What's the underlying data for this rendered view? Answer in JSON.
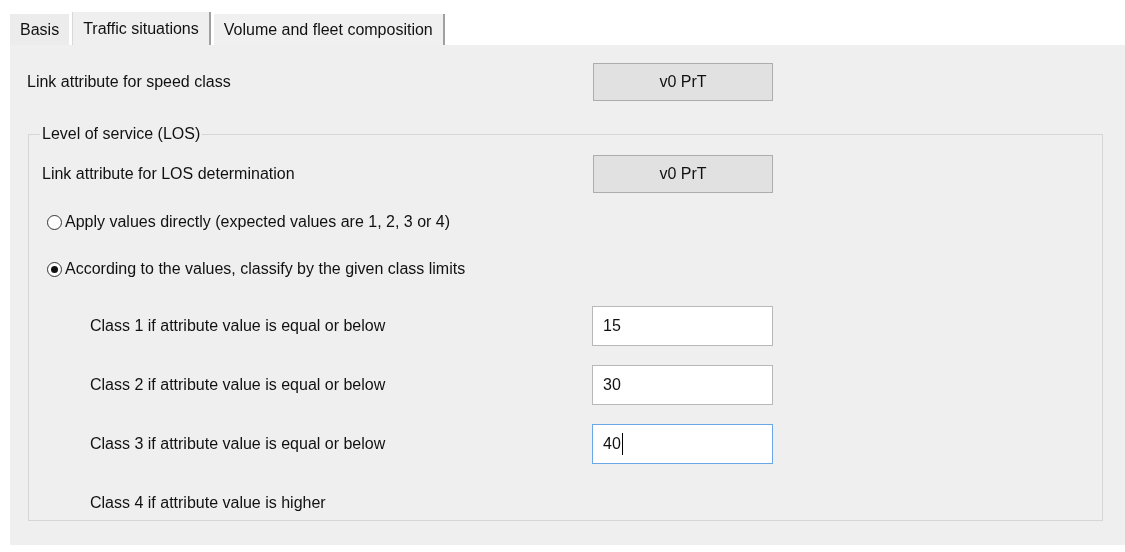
{
  "tabs": [
    {
      "label": "Basis",
      "selected": false
    },
    {
      "label": "Traffic situations",
      "selected": true
    },
    {
      "label": "Volume and fleet composition",
      "selected": false
    }
  ],
  "speed_class": {
    "label": "Link attribute for speed class",
    "button": "v0 PrT"
  },
  "los_group": {
    "title": "Level of service (LOS)",
    "attribute": {
      "label": "Link attribute for LOS determination",
      "button": "v0 PrT"
    },
    "options": [
      {
        "label": "Apply values directly (expected values are 1, 2, 3 or 4)",
        "selected": false
      },
      {
        "label": "According to the values, classify by the given class limits",
        "selected": true
      }
    ],
    "class_limits": [
      {
        "label": "Class 1 if attribute value is equal or below",
        "value": "15",
        "focused": false
      },
      {
        "label": "Class 2 if attribute value is equal or below",
        "value": "30",
        "focused": false
      },
      {
        "label": "Class 3 if attribute value is equal or below",
        "value": "40",
        "focused": true
      }
    ],
    "last_class_label": "Class 4 if attribute value is higher"
  }
}
